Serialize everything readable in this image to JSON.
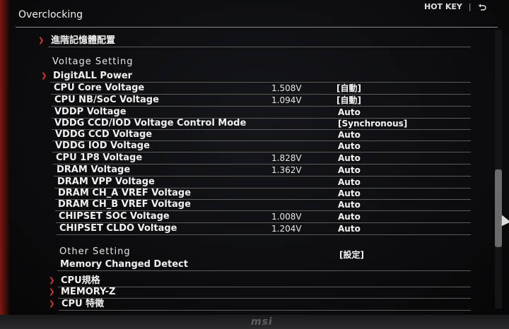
{
  "header": {
    "title": "Overclocking",
    "hotkey_label": "HOT KEY",
    "hotkey_sep": "|"
  },
  "top_item": {
    "label": "進階記憶體配置"
  },
  "voltage_section": {
    "title": "Voltage Setting",
    "items": [
      {
        "label": "DigitALL Power",
        "value": "",
        "option": ""
      },
      {
        "label": "CPU Core Voltage",
        "value": "1.508V",
        "option": "[自動]"
      },
      {
        "label": "CPU NB/SoC Voltage",
        "value": "1.094V",
        "option": "[自動]"
      },
      {
        "label": "VDDP Voltage",
        "value": "",
        "option": "Auto"
      },
      {
        "label": "VDDG CCD/IOD Voltage Control Mode",
        "value": "",
        "option": "[Synchronous]"
      },
      {
        "label": "VDDG CCD Voltage",
        "value": "",
        "option": "Auto"
      },
      {
        "label": "VDDG IOD Voltage",
        "value": "",
        "option": "Auto"
      },
      {
        "label": "CPU 1P8 Voltage",
        "value": "1.828V",
        "option": "Auto"
      },
      {
        "label": "DRAM Voltage",
        "value": "1.362V",
        "option": "Auto"
      },
      {
        "label": "DRAM VPP Voltage",
        "value": "",
        "option": "Auto"
      },
      {
        "label": "DRAM CH_A VREF Voltage",
        "value": "",
        "option": "Auto"
      },
      {
        "label": "DRAM CH_B VREF Voltage",
        "value": "",
        "option": "Auto"
      },
      {
        "label": "CHIPSET SOC Voltage",
        "value": "1.008V",
        "option": "Auto"
      },
      {
        "label": "CHIPSET CLDO Voltage",
        "value": "1.204V",
        "option": "Auto"
      }
    ]
  },
  "other_section": {
    "title": "Other Setting",
    "items": [
      {
        "label": "Memory Changed Detect",
        "option": "[設定]"
      },
      {
        "label": "CPU規格",
        "option": ""
      },
      {
        "label": "MEMORY-Z",
        "option": ""
      },
      {
        "label": "CPU 特徵",
        "option": ""
      }
    ]
  },
  "bezel": {
    "brand": "msi"
  },
  "colors": {
    "accent": "#e23a2a",
    "background": "#0c0c0e",
    "text": "#f0f0f0"
  }
}
